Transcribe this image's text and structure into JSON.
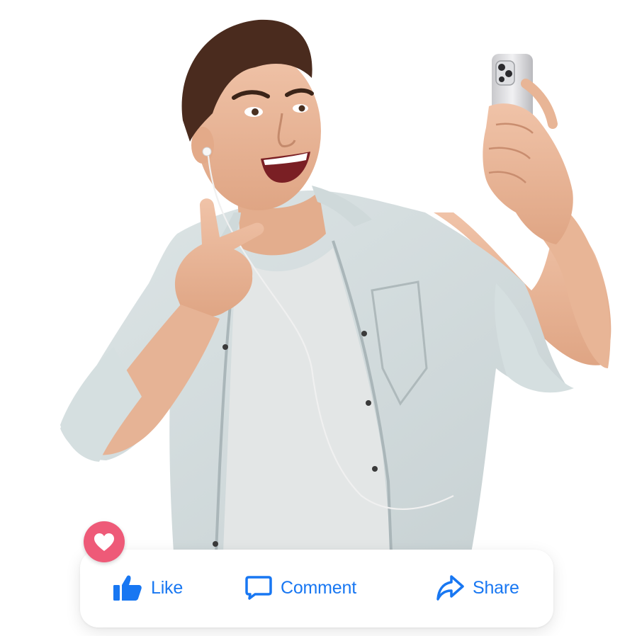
{
  "post_actions": {
    "like_label": "Like",
    "comment_label": "Comment",
    "share_label": "Share"
  },
  "reaction": {
    "icon": "heart-icon"
  },
  "icons": {
    "like": "thumbs-up-icon",
    "comment": "speech-bubble-icon",
    "share": "share-arrow-icon"
  },
  "colors": {
    "accent": "#1877f2",
    "heart": "#ee5a78",
    "card_bg": "#ffffff"
  }
}
